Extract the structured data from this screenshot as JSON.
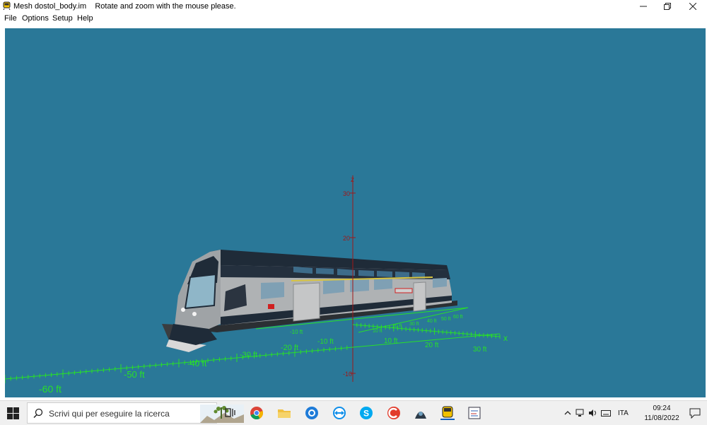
{
  "window": {
    "title": "Mesh dostol_body.im",
    "hint": "Rotate and zoom with the mouse please.",
    "minimize_icon": "minimize-icon",
    "restore_icon": "restore-icon",
    "close_icon": "close-icon"
  },
  "menu": [
    "File",
    "Options",
    "Setup",
    "Help"
  ],
  "viewport": {
    "background": "#2a7898",
    "axis_color": "#28e028",
    "z_axis_color": "#a01818",
    "axes": {
      "x_label": "x",
      "z_label": "z",
      "z_ticks": [
        "30",
        "20",
        "-10"
      ],
      "x_front_ticks": [
        "10 ft",
        "20 ft",
        "30 ft"
      ],
      "y_front_ticks": [
        "-10 ft",
        "-20 ft",
        "-30 ft",
        "-40 ft",
        "-50 ft",
        "-60 ft"
      ],
      "x_back_ticks": [
        "10 ft",
        "20 ft",
        "30 ft",
        "40 ft",
        "50 ft",
        "60 ft"
      ],
      "y_back_ticks": [
        "-10 ft"
      ]
    },
    "model": "double-deck railcar"
  },
  "taskbar": {
    "search_placeholder": "Scrivi qui per eseguire la ricerca",
    "apps": [
      "task-view-icon",
      "chrome-icon",
      "file-explorer-icon",
      "app-blue-icon",
      "teamviewer-icon",
      "skype-icon",
      "ccleaner-icon",
      "app-dark-icon",
      "train-app-icon",
      "editor-app-icon"
    ],
    "language": "ITA",
    "time": "09:24",
    "date": "11/08/2022"
  }
}
